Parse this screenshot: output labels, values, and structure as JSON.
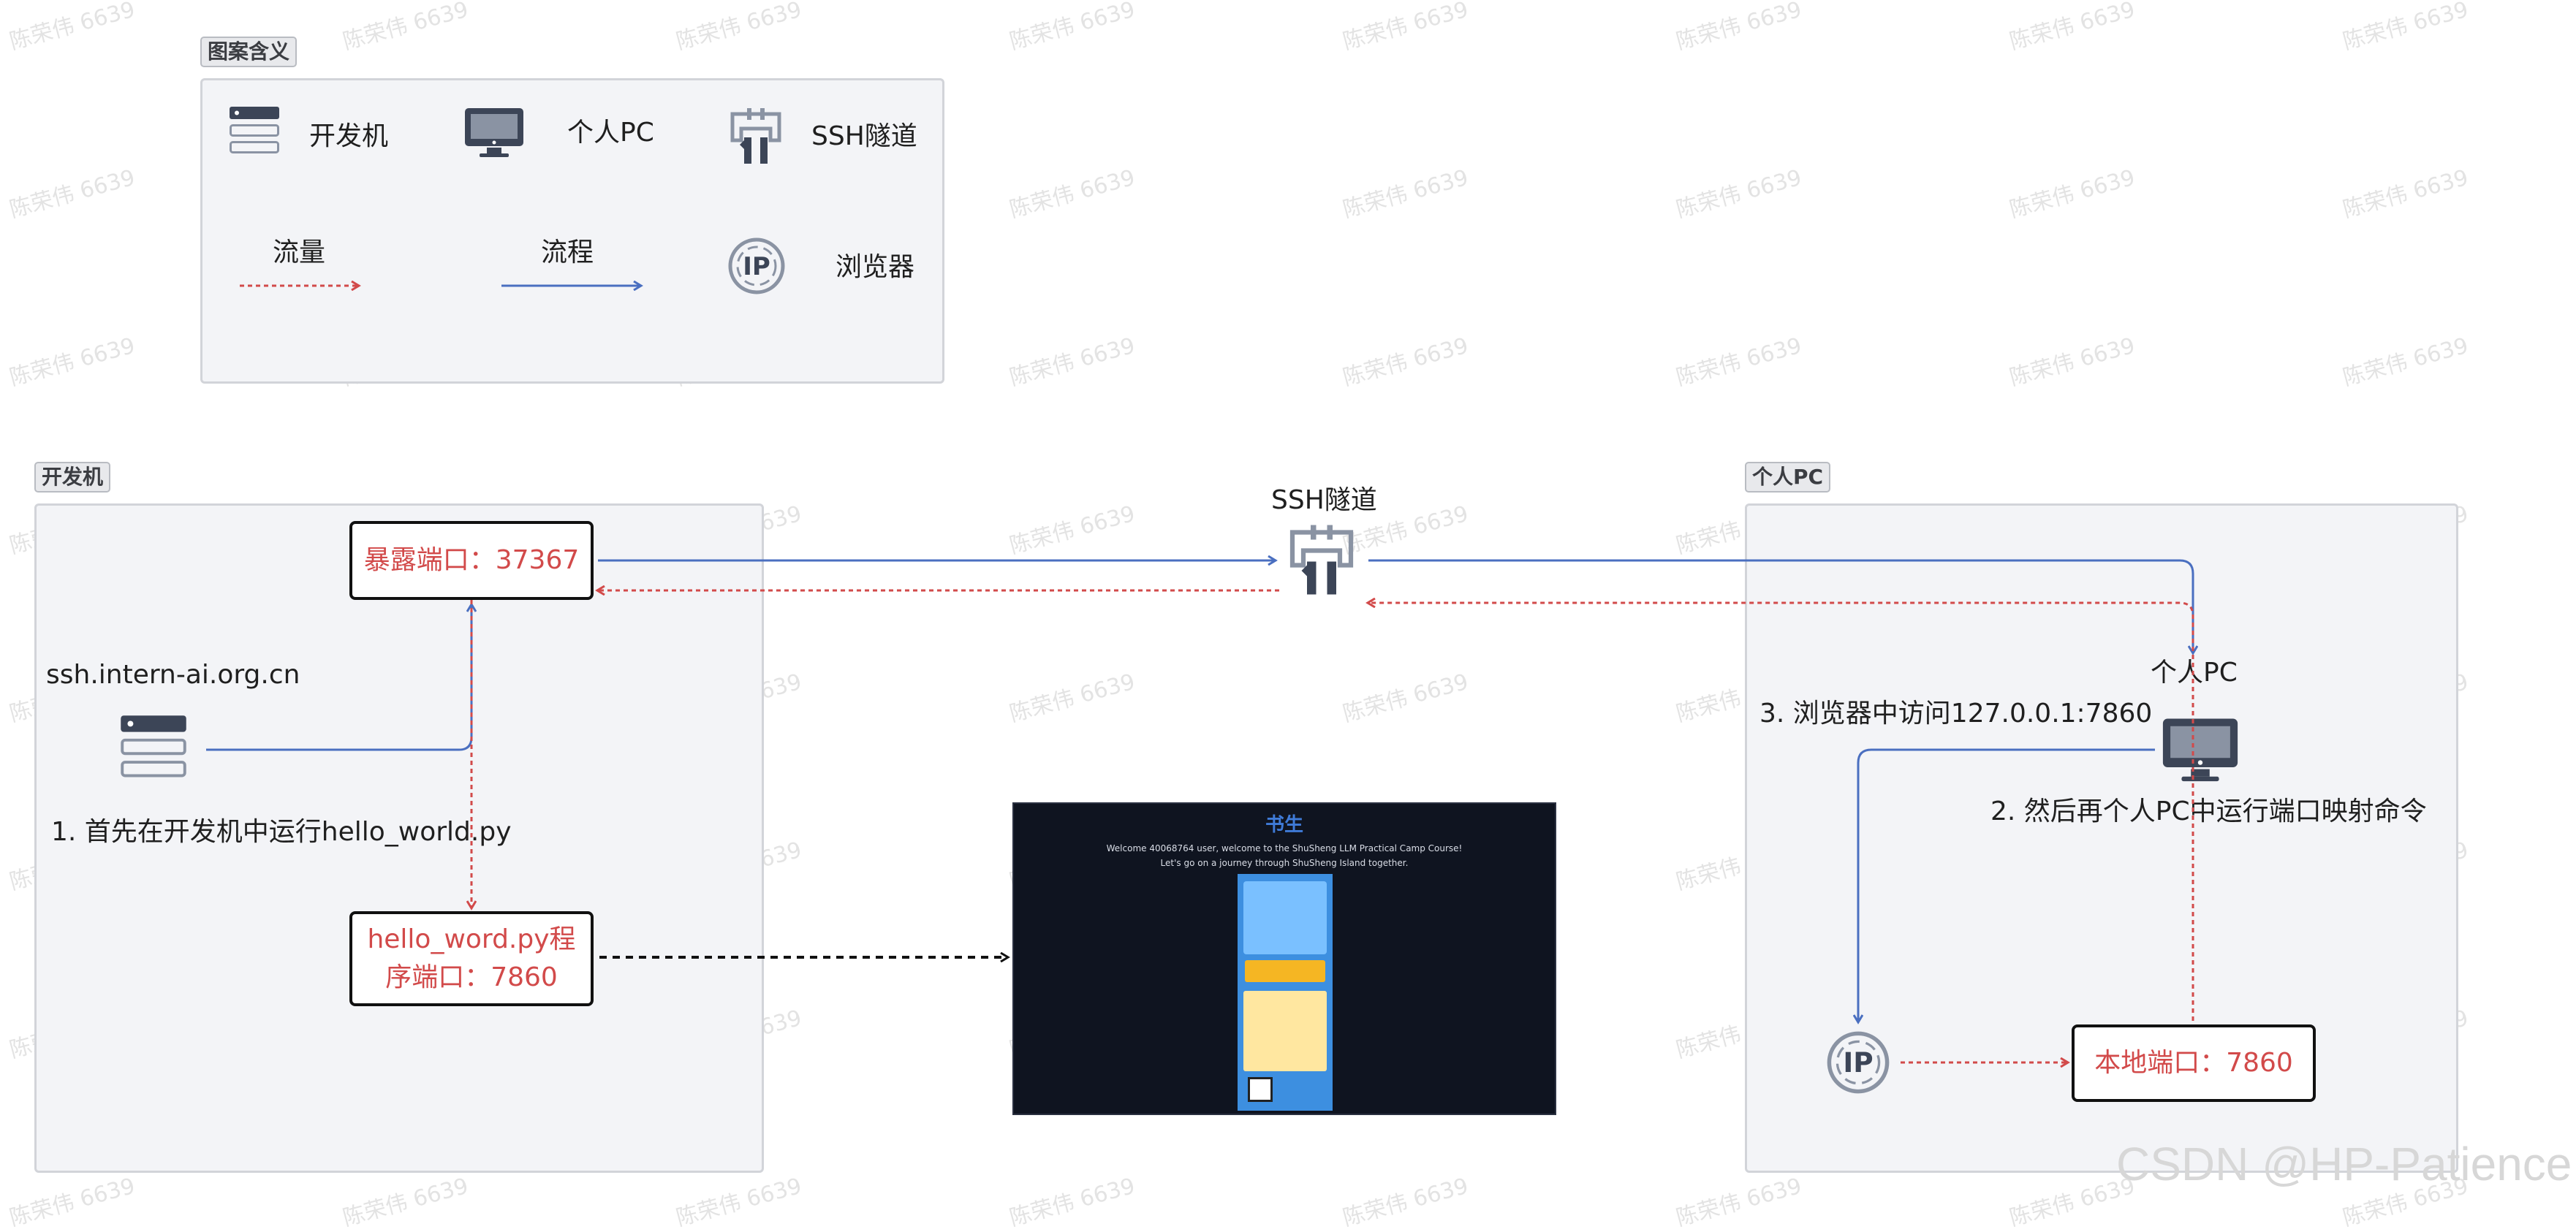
{
  "legend": {
    "tag": "图案含义",
    "dev_machine": "开发机",
    "personal_pc": "个人PC",
    "ssh_tunnel": "SSH隧道",
    "traffic": "流量",
    "flow": "流程",
    "browser": "浏览器"
  },
  "dev_group": {
    "tag": "开发机",
    "host": "ssh.intern-ai.org.cn",
    "step1": "1. 首先在开发机中运行hello_world.py",
    "exposed_port": "暴露端口：37367",
    "program_port_line1": "hello_word.py程",
    "program_port_line2": "序端口：7860"
  },
  "tunnel": {
    "label": "SSH隧道"
  },
  "pc_group": {
    "tag": "个人PC",
    "pc_label": "个人PC",
    "step3": "3. 浏览器中访问127.0.0.1:7860",
    "step2": "2. 然后再个人PC中运行端口映射命令",
    "local_port": "本地端口：7860"
  },
  "screenshot": {
    "logo": "书生",
    "welcome": "Welcome 40068764 user, welcome to the ShuSheng LLM Practical Camp Course!",
    "journey": "Let's go on a journey through ShuSheng Island together."
  },
  "watermark": "陈荣伟 6639",
  "credit": "CSDN @HP-Patience",
  "colors": {
    "traffic": "#d24a4a",
    "flow": "#4a6fc0",
    "icon": "#3c4557",
    "group_bg": "#f3f4f7"
  }
}
